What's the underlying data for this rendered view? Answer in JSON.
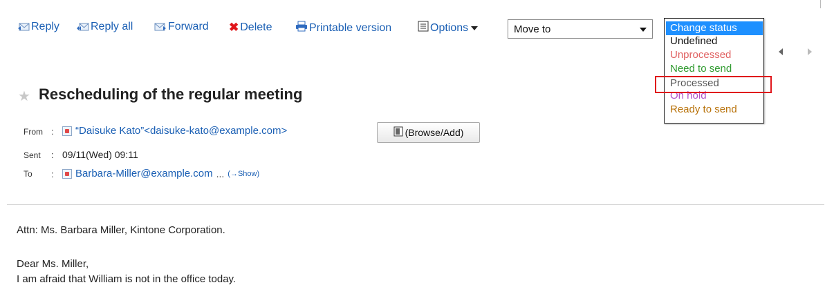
{
  "toolbar": {
    "reply": "Reply",
    "reply_all": "Reply all",
    "forward": "Forward",
    "delete": "Delete",
    "printable": "Printable version",
    "options": "Options"
  },
  "move_to": {
    "selected": "Move to"
  },
  "status_dropdown": {
    "options": [
      {
        "label": "Change status",
        "color": "#ffffff",
        "bg": "#1e90ff"
      },
      {
        "label": "Undefined",
        "color": "#111111"
      },
      {
        "label": "Unprocessed",
        "color": "#e06060"
      },
      {
        "label": "Need to send",
        "color": "#2e9a2e"
      },
      {
        "label": "Processed",
        "color": "#555555"
      },
      {
        "label": "On hold",
        "color": "#b050c8"
      },
      {
        "label": "Ready to send",
        "color": "#b8720a"
      }
    ],
    "highlighted": "Processed"
  },
  "message": {
    "subject": "Rescheduling of the regular meeting",
    "from_label": "From",
    "from_value": "“Daisuke Kato”<daisuke-kato@example.com>",
    "browse_add": "(Browse/Add)",
    "sent_label": "Sent",
    "sent_value": "09/11(Wed) 09:11",
    "to_label": "To",
    "to_value": "Barbara-Miller@example.com",
    "to_more": "...",
    "show_link": "(→Show)",
    "colon": ":"
  },
  "body": {
    "line1": "Attn: Ms. Barbara Miller, Kintone Corporation.",
    "line2": "Dear Ms. Miller,",
    "line3": "I am afraid that William is not in the office today."
  },
  "colors": {
    "link": "#1a5fb4",
    "delete_x": "#e0161b",
    "highlight": "#e0161b"
  }
}
